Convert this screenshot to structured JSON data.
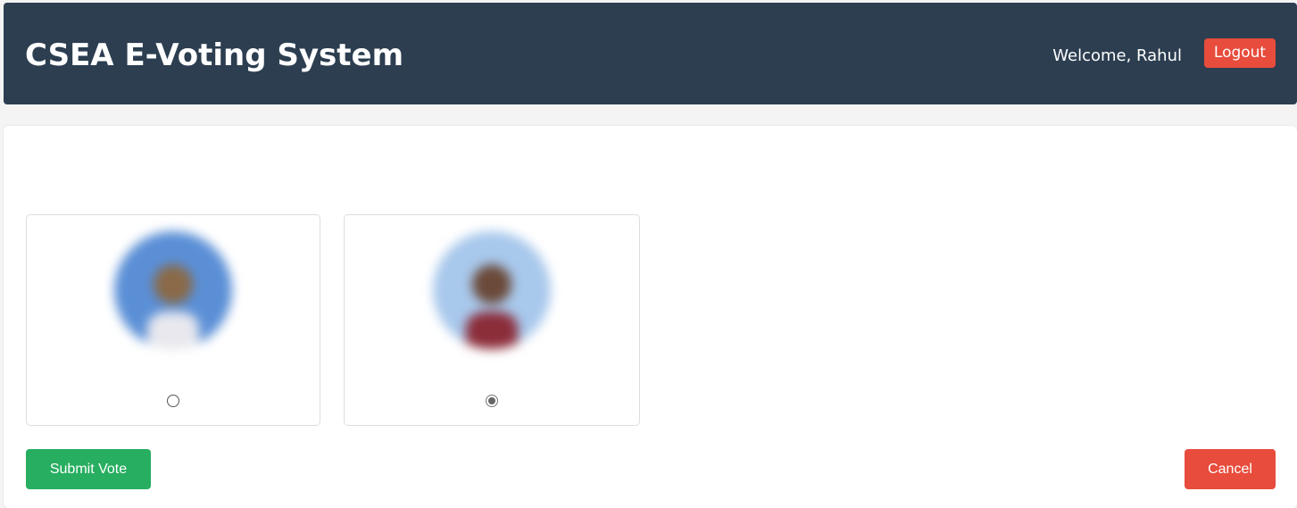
{
  "header": {
    "title": "CSEA E-Voting System",
    "welcome_text": "Welcome, Rahul",
    "logout_label": "Logout"
  },
  "ballot": {
    "position_title": "",
    "candidates": [
      {
        "name": "",
        "selected": false,
        "photo": "candidate-photo"
      },
      {
        "name": "",
        "selected": true,
        "photo": "candidate-photo"
      }
    ],
    "submit_label": "Submit Vote",
    "cancel_label": "Cancel"
  },
  "colors": {
    "header_bg": "#2c3e50",
    "logout_bg": "#e74c3c",
    "submit_bg": "#27ae60",
    "cancel_bg": "#e74c3c"
  }
}
